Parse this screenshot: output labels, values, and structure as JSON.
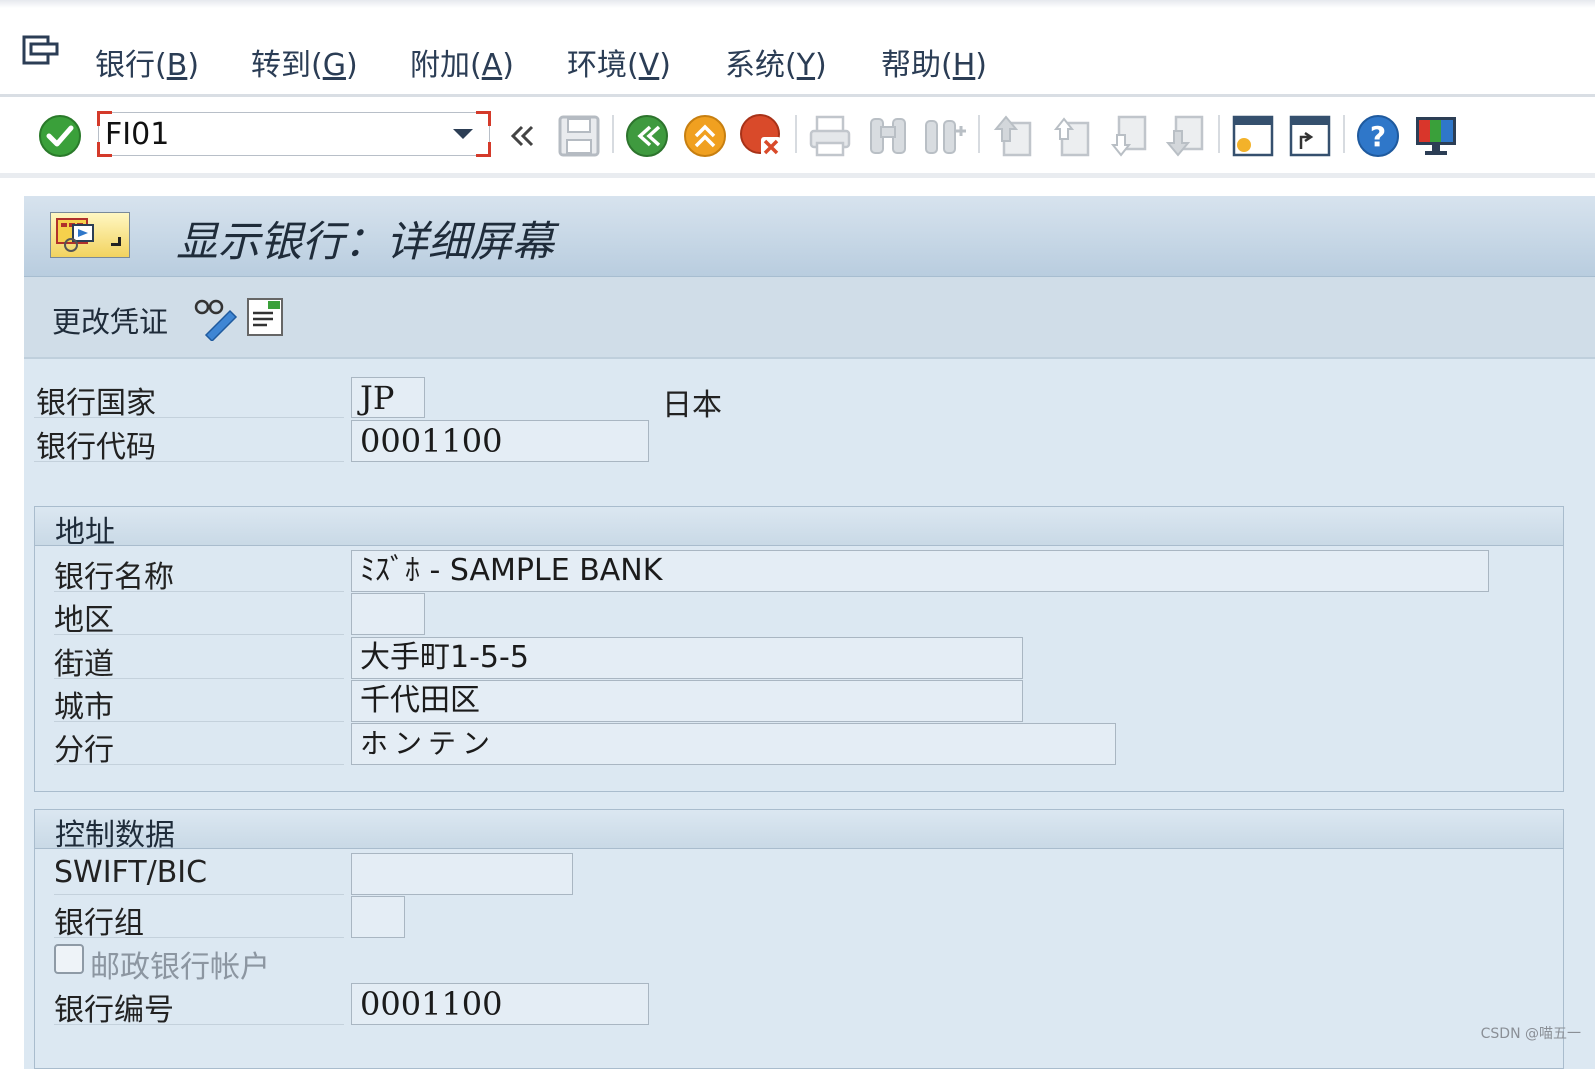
{
  "menu": {
    "items": [
      {
        "label": "银行(",
        "mnemonic": "B",
        "close": ")"
      },
      {
        "label": "转到(",
        "mnemonic": "G",
        "close": ")"
      },
      {
        "label": "附加(",
        "mnemonic": "A",
        "close": ")"
      },
      {
        "label": "环境(",
        "mnemonic": "V",
        "close": ")"
      },
      {
        "label": "系统(",
        "mnemonic": "Y",
        "close": ")"
      },
      {
        "label": "帮助(",
        "mnemonic": "H",
        "close": ")"
      }
    ]
  },
  "toolbar": {
    "command_value": "FI01",
    "icons": [
      "enter-check-icon",
      "collapse-chevrons-icon",
      "save-icon",
      "back-icon",
      "exit-icon",
      "cancel-icon",
      "print-icon",
      "find-icon",
      "find-next-icon",
      "first-page-icon",
      "previous-page-icon",
      "next-page-icon",
      "last-page-icon",
      "create-session-icon",
      "shortcut-icon",
      "help-icon",
      "customize-layout-icon"
    ],
    "colors": {
      "ok": "#3aa03a",
      "back": "#3f9a3f",
      "exit": "#f0a020",
      "cancel": "#d94a2a",
      "help": "#2f77c9"
    }
  },
  "screen": {
    "title": "显示银行：详细屏幕",
    "change_documents_label": "更改凭证"
  },
  "header_fields": {
    "bank_country_label": "银行国家",
    "bank_country_value": "JP",
    "bank_country_name": "日本",
    "bank_key_label": "银行代码",
    "bank_key_value": "0001100"
  },
  "address": {
    "title": "地址",
    "bank_name_label": "银行名称",
    "bank_name_value": "ﾐｽﾞﾎ - SAMPLE BANK",
    "region_label": "地区",
    "region_value": "",
    "street_label": "街道",
    "street_value": "大手町1-5-5",
    "city_label": "城市",
    "city_value": "千代田区",
    "branch_label": "分行",
    "branch_value": "ホンテン"
  },
  "control": {
    "title": "控制数据",
    "swift_label": "SWIFT/BIC",
    "swift_value": "",
    "bank_group_label": "银行组",
    "bank_group_value": "",
    "postbank_label": "邮政银行帐户",
    "postbank_checked": false,
    "bank_number_label": "银行编号",
    "bank_number_value": "0001100"
  },
  "watermark": "CSDN @喵五一"
}
